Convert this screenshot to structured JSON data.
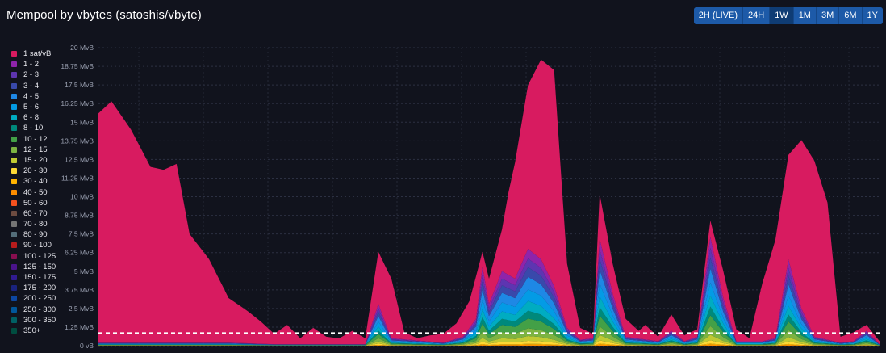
{
  "header": {
    "title": "Mempool by vbytes (satoshis/vbyte)",
    "ranges": [
      "2H (LIVE)",
      "24H",
      "1W",
      "1M",
      "3M",
      "6M",
      "1Y"
    ],
    "active_range": "1W"
  },
  "colors": {
    "background": "#11131d",
    "range_button": "#1d5aa8",
    "range_button_active": "#0f3c74",
    "limit_line": "#ffffff"
  },
  "legend": [
    {
      "label": "1 sat/vB",
      "color": "#d81b60"
    },
    {
      "label": "1 - 2",
      "color": "#8e24aa"
    },
    {
      "label": "2 - 3",
      "color": "#5e35b1"
    },
    {
      "label": "3 - 4",
      "color": "#3949ab"
    },
    {
      "label": "4 - 5",
      "color": "#1e88e5"
    },
    {
      "label": "5 - 6",
      "color": "#039be5"
    },
    {
      "label": "6 - 8",
      "color": "#00acc1"
    },
    {
      "label": "8 - 10",
      "color": "#00897b"
    },
    {
      "label": "10 - 12",
      "color": "#43a047"
    },
    {
      "label": "12 - 15",
      "color": "#7cb342"
    },
    {
      "label": "15 - 20",
      "color": "#c0ca33"
    },
    {
      "label": "20 - 30",
      "color": "#fdd835"
    },
    {
      "label": "30 - 40",
      "color": "#ffb300"
    },
    {
      "label": "40 - 50",
      "color": "#fb8c00"
    },
    {
      "label": "50 - 60",
      "color": "#f4511e"
    },
    {
      "label": "60 - 70",
      "color": "#6d4c41"
    },
    {
      "label": "70 - 80",
      "color": "#757575"
    },
    {
      "label": "80 - 90",
      "color": "#546e7a"
    },
    {
      "label": "90 - 100",
      "color": "#b71c1c"
    },
    {
      "label": "100 - 125",
      "color": "#880e4f"
    },
    {
      "label": "125 - 150",
      "color": "#4a148c"
    },
    {
      "label": "150 - 175",
      "color": "#311b92"
    },
    {
      "label": "175 - 200",
      "color": "#1a237e"
    },
    {
      "label": "200 - 250",
      "color": "#0d47a1"
    },
    {
      "label": "250 - 300",
      "color": "#01579b"
    },
    {
      "label": "300 - 350",
      "color": "#006064"
    },
    {
      "label": "350+",
      "color": "#004d40"
    }
  ],
  "chart_data": {
    "type": "area",
    "stacked": true,
    "title": "Mempool by vbytes (satoshis/vbyte)",
    "ylabel": "",
    "ylim": [
      0,
      20
    ],
    "y_unit": "MvB",
    "y_ticks": [
      "0 vB",
      "1.25 MvB",
      "2.5 MvB",
      "3.75 MvB",
      "5 MvB",
      "6.25 MvB",
      "7.5 MvB",
      "8.75 MvB",
      "10 MvB",
      "11.25 MvB",
      "12.5 MvB",
      "13.75 MvB",
      "15 MvB",
      "16.25 MvB",
      "17.5 MvB",
      "18.75 MvB",
      "20 MvB"
    ],
    "limit_line": 0.85,
    "grid": true,
    "legend_position": "left",
    "x_count": 121,
    "total_keyframes": [
      [
        0,
        15.6
      ],
      [
        2,
        16.4
      ],
      [
        5,
        14.5
      ],
      [
        8,
        12.0
      ],
      [
        10,
        11.8
      ],
      [
        12,
        12.2
      ],
      [
        14,
        7.5
      ],
      [
        17,
        5.8
      ],
      [
        20,
        3.2
      ],
      [
        23,
        2.3
      ],
      [
        25,
        1.6
      ],
      [
        27,
        0.8
      ],
      [
        29,
        1.4
      ],
      [
        31,
        0.5
      ],
      [
        33,
        1.2
      ],
      [
        35,
        0.6
      ],
      [
        37,
        0.5
      ],
      [
        39,
        1.0
      ],
      [
        41,
        0.5
      ],
      [
        43,
        6.3
      ],
      [
        45,
        4.5
      ],
      [
        47,
        0.9
      ],
      [
        49,
        0.5
      ],
      [
        51,
        0.7
      ],
      [
        53,
        0.8
      ],
      [
        55,
        1.5
      ],
      [
        57,
        3.0
      ],
      [
        59,
        6.3
      ],
      [
        60,
        4.5
      ],
      [
        62,
        7.8
      ],
      [
        63,
        10.3
      ],
      [
        64,
        12.3
      ],
      [
        66,
        17.5
      ],
      [
        68,
        19.2
      ],
      [
        70,
        18.5
      ],
      [
        71,
        12.0
      ],
      [
        72,
        5.5
      ],
      [
        74,
        1.2
      ],
      [
        76,
        0.8
      ],
      [
        77,
        10.2
      ],
      [
        79,
        5.5
      ],
      [
        81,
        1.8
      ],
      [
        83,
        1.0
      ],
      [
        84,
        1.4
      ],
      [
        86,
        0.6
      ],
      [
        88,
        2.1
      ],
      [
        90,
        0.7
      ],
      [
        92,
        1.1
      ],
      [
        94,
        8.4
      ],
      [
        96,
        5.0
      ],
      [
        98,
        1.1
      ],
      [
        100,
        0.5
      ],
      [
        102,
        4.2
      ],
      [
        104,
        7.1
      ],
      [
        106,
        12.8
      ],
      [
        108,
        13.8
      ],
      [
        110,
        12.4
      ],
      [
        112,
        9.6
      ],
      [
        114,
        0.6
      ],
      [
        116,
        0.9
      ],
      [
        118,
        1.4
      ],
      [
        120,
        0.3
      ]
    ],
    "total_series_note": "",
    "series": [
      {
        "name": "1 sat/vB",
        "values": []
      },
      {
        "name": "1 - 2",
        "values": []
      },
      {
        "name": "2 - 3",
        "values": []
      },
      {
        "name": "3 - 4",
        "values": []
      },
      {
        "name": "4 - 5",
        "values": []
      },
      {
        "name": "5 - 6",
        "values": []
      },
      {
        "name": "6 - 8",
        "values": []
      },
      {
        "name": "8 - 10",
        "values": []
      },
      {
        "name": "10 - 12",
        "values": []
      },
      {
        "name": "12 - 15",
        "values": []
      },
      {
        "name": "15 - 20",
        "values": []
      },
      {
        "name": "20 - 30",
        "values": []
      },
      {
        "name": "30 - 40",
        "values": []
      },
      {
        "name": "40 - 50",
        "values": []
      }
    ],
    "mid_keyframes": [
      [
        0,
        0.2
      ],
      [
        14,
        0.2
      ],
      [
        20,
        0.2
      ],
      [
        27,
        0.1
      ],
      [
        41,
        0.1
      ],
      [
        43,
        2.8
      ],
      [
        45,
        0.5
      ],
      [
        53,
        0.2
      ],
      [
        56,
        0.6
      ],
      [
        58,
        1.8
      ],
      [
        59,
        5.3
      ],
      [
        60,
        2.8
      ],
      [
        62,
        5.0
      ],
      [
        64,
        4.5
      ],
      [
        66,
        6.5
      ],
      [
        68,
        5.8
      ],
      [
        70,
        4.0
      ],
      [
        72,
        1.2
      ],
      [
        74,
        0.4
      ],
      [
        76,
        0.5
      ],
      [
        77,
        7.2
      ],
      [
        79,
        3.5
      ],
      [
        81,
        0.6
      ],
      [
        86,
        0.3
      ],
      [
        88,
        1.0
      ],
      [
        90,
        0.3
      ],
      [
        92,
        0.6
      ],
      [
        94,
        7.3
      ],
      [
        96,
        3.2
      ],
      [
        98,
        0.3
      ],
      [
        102,
        0.3
      ],
      [
        104,
        0.5
      ],
      [
        106,
        5.8
      ],
      [
        108,
        2.5
      ],
      [
        110,
        0.6
      ],
      [
        114,
        0.2
      ],
      [
        116,
        0.3
      ],
      [
        118,
        1.0
      ],
      [
        120,
        0.1
      ]
    ]
  }
}
